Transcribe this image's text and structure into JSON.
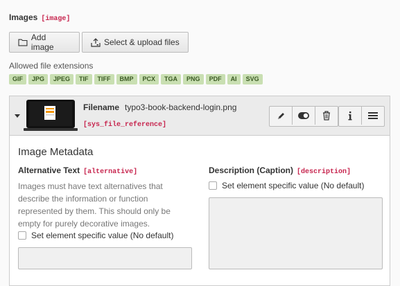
{
  "field": {
    "label": "Images",
    "tag": "[image]"
  },
  "buttons": {
    "add_image": "Add image",
    "select_upload": "Select & upload files"
  },
  "extensions": {
    "title": "Allowed file extensions",
    "items": [
      "GIF",
      "JPG",
      "JPEG",
      "TIF",
      "TIFF",
      "BMP",
      "PCX",
      "TGA",
      "PNG",
      "PDF",
      "AI",
      "SVG"
    ]
  },
  "file": {
    "filename_label": "Filename",
    "filename": "typo3-book-backend-login.png",
    "ref_tag": "[sys_file_reference]"
  },
  "metadata": {
    "title": "Image Metadata",
    "alternative": {
      "label": "Alternative Text",
      "tag": "[alternative]",
      "help": "Images must have text alternatives that describe the information or function represented by them. This should only be empty for purely decorative images.",
      "checkbox": "Set element specific value (No default)"
    },
    "description": {
      "label": "Description (Caption)",
      "tag": "[description]",
      "checkbox": "Set element specific value (No default)"
    }
  },
  "colors": {
    "tag": "#c7254e",
    "badge_bg": "#c9dfb2",
    "badge_text": "#3b5a23"
  }
}
